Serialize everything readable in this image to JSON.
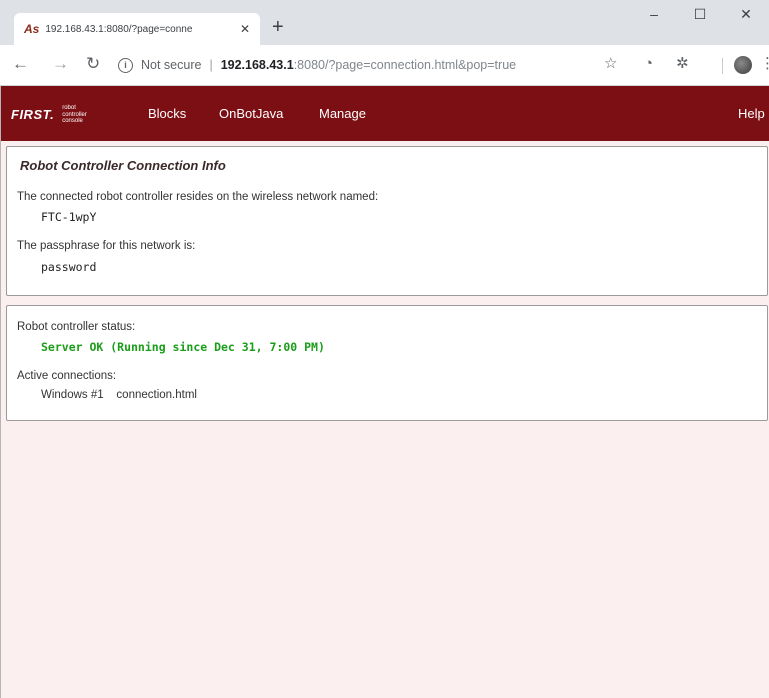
{
  "browser": {
    "tab_title": "192.168.43.1:8080/?page=conne",
    "tab_favicon": "As",
    "new_tab": "+",
    "window_controls": {
      "minimize": "–",
      "maximize": "☐",
      "close": "✕"
    },
    "omnibox": {
      "security_label": "Not secure",
      "url_host": "192.168.43.1",
      "url_rest": ":8080/?page=connection.html&pop=true"
    },
    "icons": [
      "back-icon",
      "forward-icon",
      "reload-icon",
      "info-icon",
      "star-icon",
      "extension-icon",
      "puzzle-icon",
      "avatar",
      "menu-icon"
    ]
  },
  "navbar": {
    "logo_first": "FIRST.",
    "logo_sub": "robot controller console",
    "links": [
      "Blocks",
      "OnBotJava",
      "Manage"
    ],
    "help": "Help"
  },
  "connection_info": {
    "title": "Robot Controller Connection Info",
    "network_label": "The connected robot controller resides on the wireless network named:",
    "network_name": "FTC-1wpY",
    "passphrase_label": "The passphrase for this network is:",
    "passphrase": "password"
  },
  "status": {
    "status_label": "Robot controller status:",
    "status_value": "Server OK (Running since Dec 31, 7:00 PM)",
    "connections_label": "Active connections:",
    "connections": [
      {
        "client": "Windows #1",
        "page": "connection.html"
      }
    ]
  },
  "colors": {
    "navbar_bg": "#7b0f14",
    "page_bg": "#fcefef",
    "status_ok": "#1a9e1a"
  }
}
